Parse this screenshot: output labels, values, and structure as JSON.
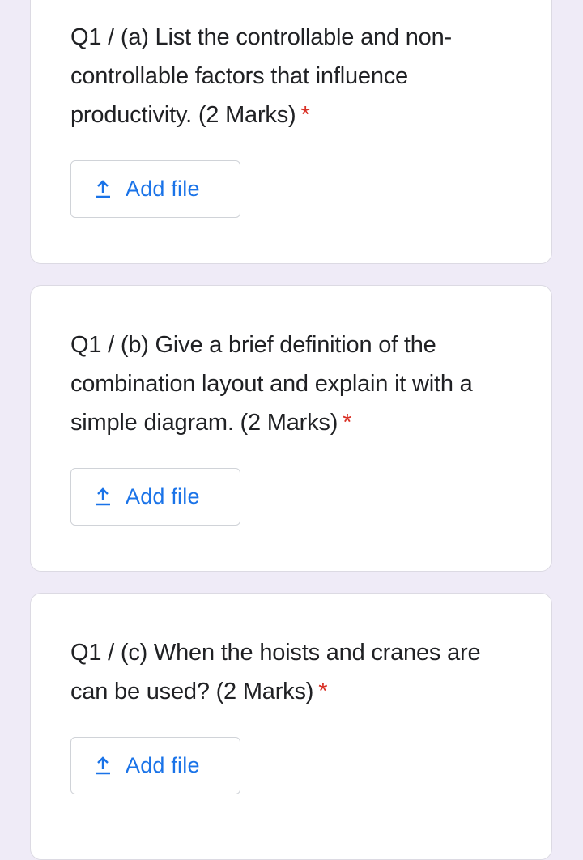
{
  "questions": [
    {
      "text": "Q1 / (a) List the controllable and non-controllable factors that influence productivity. (2 Marks)",
      "required_marker": "*",
      "button_label": "Add file",
      "button_icon": "upload-icon"
    },
    {
      "text": "Q1 / (b) Give a brief definition of the combination layout and explain it with a simple diagram. (2 Marks)",
      "required_marker": "*",
      "button_label": "Add file",
      "button_icon": "upload-icon"
    },
    {
      "text": "Q1 / (c) When the hoists and cranes are can be used? (2 Marks)",
      "required_marker": "*",
      "button_label": "Add file",
      "button_icon": "upload-icon"
    }
  ],
  "colors": {
    "page_background": "#efebf7",
    "card_background": "#ffffff",
    "accent": "#1a73e8",
    "required": "#d93025",
    "text": "#202124"
  }
}
